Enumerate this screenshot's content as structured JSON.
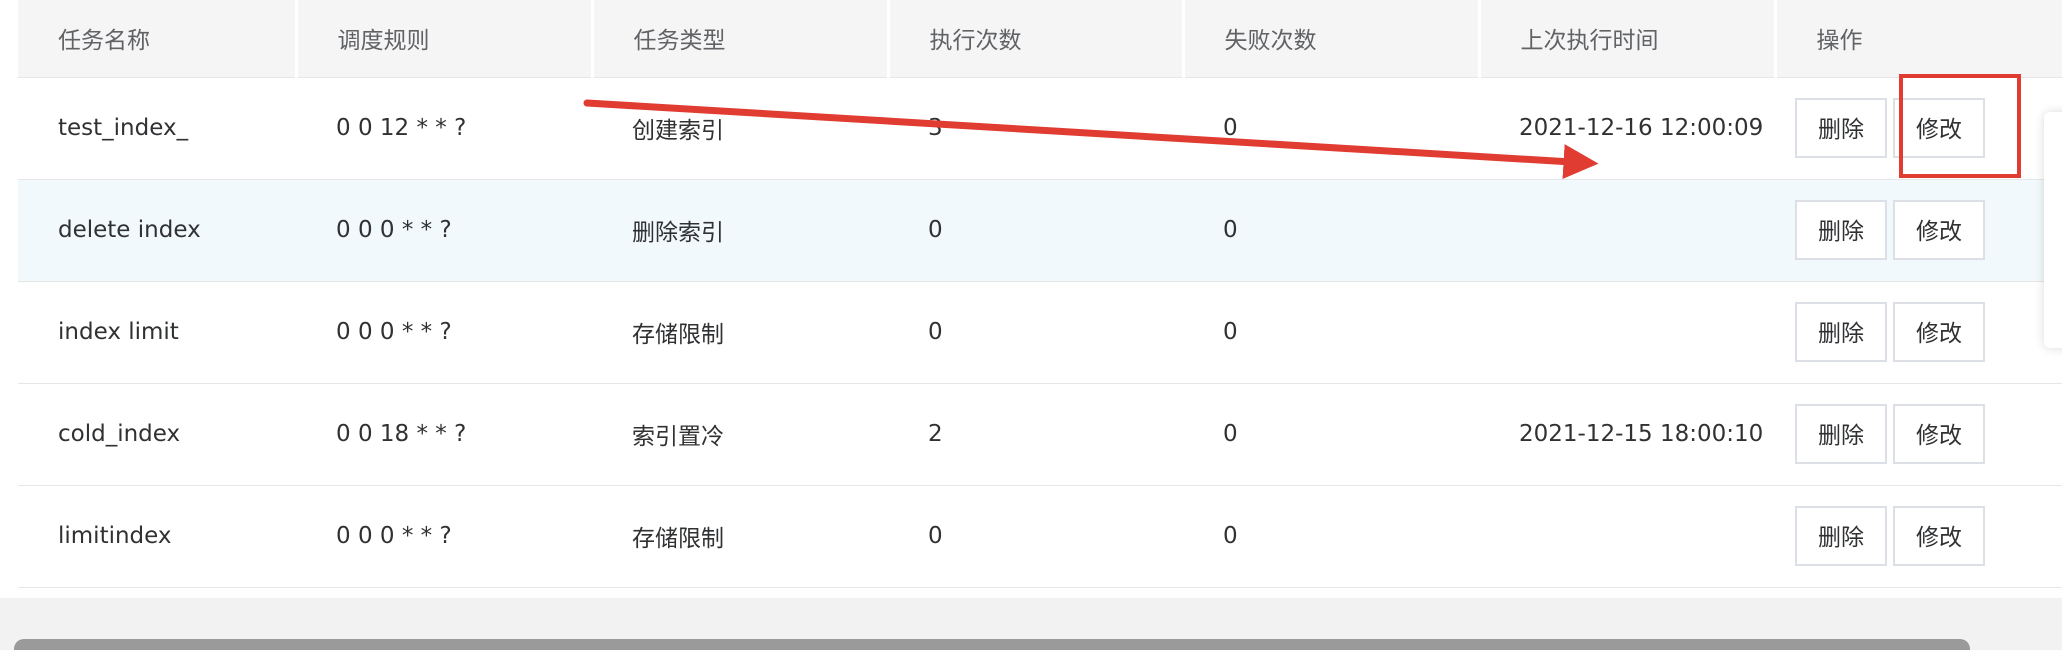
{
  "table": {
    "headers": [
      "任务名称",
      "调度规则",
      "任务类型",
      "执行次数",
      "失败次数",
      "上次执行时间",
      "操作"
    ],
    "rows": [
      {
        "name": "test_index_",
        "rule": "0 0 12 * * ?",
        "type": "创建索引",
        "exec_count": "3",
        "fail_count": "0",
        "last_time": "2021-12-16 12:00:09"
      },
      {
        "name": "delete index",
        "rule": "0 0 0 * * ?",
        "type": "删除索引",
        "exec_count": "0",
        "fail_count": "0",
        "last_time": ""
      },
      {
        "name": "index limit",
        "rule": "0 0 0 * * ?",
        "type": "存储限制",
        "exec_count": "0",
        "fail_count": "0",
        "last_time": ""
      },
      {
        "name": "cold_index",
        "rule": "0 0 18 * * ?",
        "type": "索引置冷",
        "exec_count": "2",
        "fail_count": "0",
        "last_time": "2021-12-15 18:00:10"
      },
      {
        "name": "limitindex",
        "rule": "0 0 0 * * ?",
        "type": "存储限制",
        "exec_count": "0",
        "fail_count": "0",
        "last_time": ""
      }
    ],
    "actions": {
      "delete_label": "删除",
      "edit_label": "修改"
    }
  },
  "annotation": {
    "color": "#e03c31"
  }
}
